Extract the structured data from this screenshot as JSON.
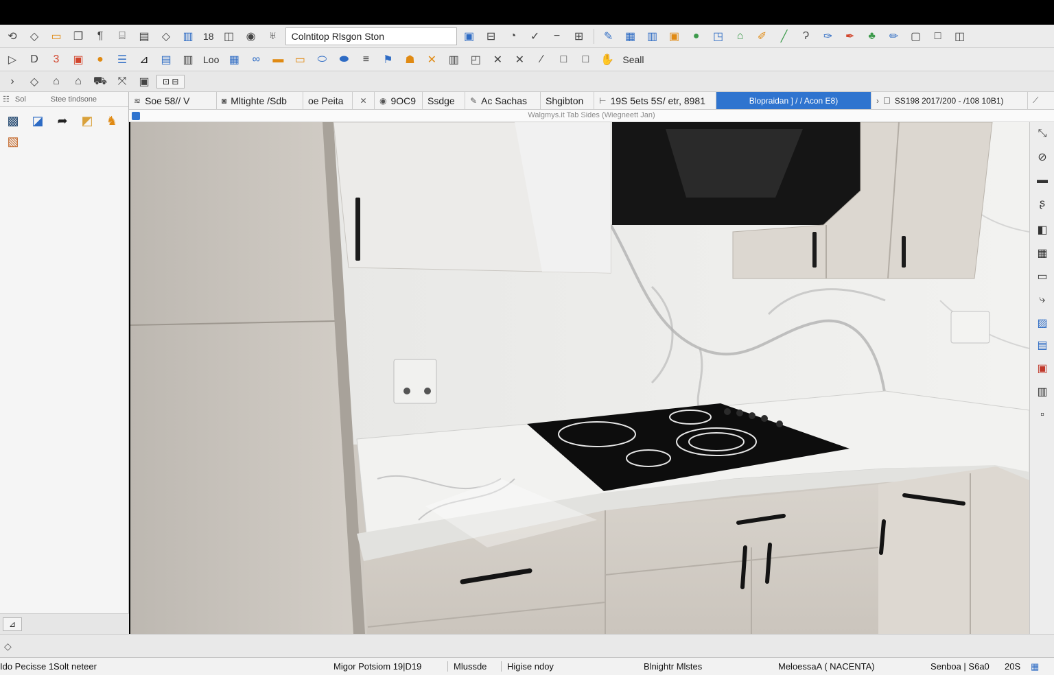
{
  "toolbar1": {
    "zoom_text": "18",
    "search_value": "Colntitop Rlsgon Ston"
  },
  "toolbar2": {
    "text_label": "Loo",
    "search_label": "Seall"
  },
  "left_panel": {
    "tab_label": "Sol",
    "title": "Stee tindsone"
  },
  "tabs": [
    {
      "label": "Soe 58// V"
    },
    {
      "label": "Mltighte /Sdb"
    },
    {
      "label": "oe Peita"
    },
    {
      "label": "9OC9"
    },
    {
      "label": "Ssdge"
    },
    {
      "label": "Ac Sachas"
    },
    {
      "label": "Shgibton"
    },
    {
      "label": "19S 5ets 5S/ etr, 8981"
    },
    {
      "label": "Blopraidan ] / / Acon E8)"
    },
    {
      "label": "SS198 2017/200 - /108 10B1)"
    }
  ],
  "subbar_text": "Walgmys.it Tab Sides (Wiegneett Jan)",
  "statusbar": {
    "left": "Ido Pecisse 1Solt neteer",
    "item1": "Migor Potsiom 19|D19",
    "item2": "Mlussde",
    "item3": "Higise ndoy",
    "item4": "Blnightr Mlstes",
    "item5": "MeloessaA ( NACENTA)",
    "item6": "Senboa | S6a0",
    "item7": "20S"
  }
}
